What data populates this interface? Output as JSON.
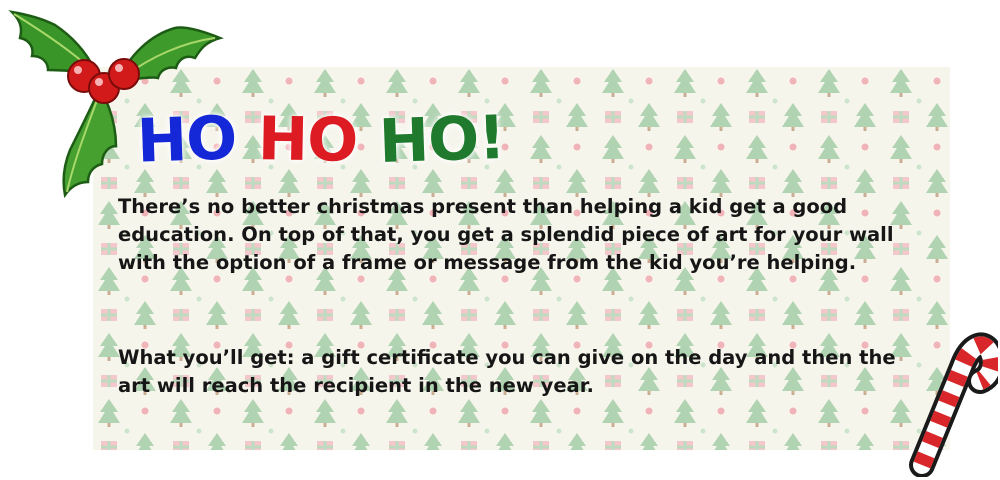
{
  "headline": {
    "words": [
      "HO",
      "HO",
      "HO!"
    ],
    "colors": [
      "#1528d8",
      "#dd1b22",
      "#1f7a2d"
    ]
  },
  "body": {
    "paragraph1": "There’s no better christmas present than helping a kid get a good education. On top of that, you get a splendid piece of art for your wall with the option of a frame or message from the kid you’re helping.",
    "paragraph2": "What you’ll get: a gift certificate you can give on the day and then the art will reach the recipient in the new year."
  },
  "decorations": {
    "background_pattern": "christmas-tree-pattern",
    "top_left": "holly-icon",
    "bottom_right": "candy-cane-icon",
    "pattern_colors": [
      "#a8cfac",
      "#f0aab2",
      "#c8e2c8"
    ]
  }
}
